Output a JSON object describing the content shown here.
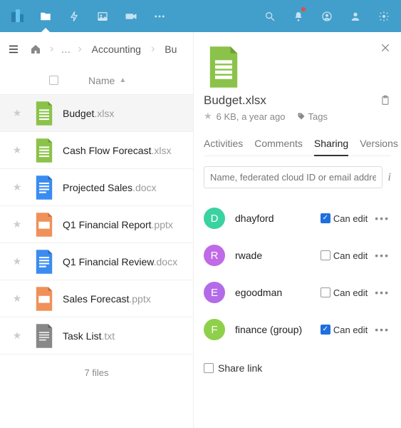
{
  "topnav": {
    "icons": [
      "files-icon",
      "activity-icon",
      "gallery-icon",
      "video-icon",
      "more-icon"
    ],
    "right_icons": [
      "search-icon",
      "notifications-icon",
      "contacts-icon",
      "users-icon",
      "settings-icon"
    ]
  },
  "breadcrumb": {
    "items": [
      "Accounting",
      "Budget"
    ],
    "truncated_visible": "Bu"
  },
  "list": {
    "header_name": "Name",
    "files": [
      {
        "base": "Budget",
        "ext": ".xlsx",
        "icon": "sheet",
        "selected": true
      },
      {
        "base": "Cash Flow Forecast",
        "ext": ".xlsx",
        "icon": "sheet"
      },
      {
        "base": "Projected Sales",
        "ext": ".docx",
        "icon": "doc"
      },
      {
        "base": "Q1 Financial Report",
        "ext": ".pptx",
        "icon": "pres"
      },
      {
        "base": "Q1 Financial Review",
        "ext": ".docx",
        "icon": "doc"
      },
      {
        "base": "Sales Forecast",
        "ext": ".pptx",
        "icon": "pres"
      },
      {
        "base": "Task List",
        "ext": ".txt",
        "icon": "txt"
      }
    ],
    "summary": "7 files"
  },
  "details": {
    "filename": "Budget.xlsx",
    "size_age": "6 KB, a year ago",
    "tags_label": "Tags",
    "tabs": [
      {
        "label": "Activities",
        "active": false
      },
      {
        "label": "Comments",
        "active": false
      },
      {
        "label": "Sharing",
        "active": true
      },
      {
        "label": "Versions",
        "active": false
      }
    ],
    "share_placeholder": "Name, federated cloud ID or email address",
    "shares": [
      {
        "initial": "D",
        "name": "dhayford",
        "color": "#3ad2a0",
        "can_edit": true
      },
      {
        "initial": "R",
        "name": "rwade",
        "color": "#c06ae8",
        "can_edit": false
      },
      {
        "initial": "E",
        "name": "egoodman",
        "color": "#b36be8",
        "can_edit": false
      },
      {
        "initial": "F",
        "name": "finance (group)",
        "color": "#8fd04a",
        "can_edit": true
      }
    ],
    "can_edit_label": "Can edit",
    "share_link_label": "Share link",
    "share_link_checked": false
  }
}
